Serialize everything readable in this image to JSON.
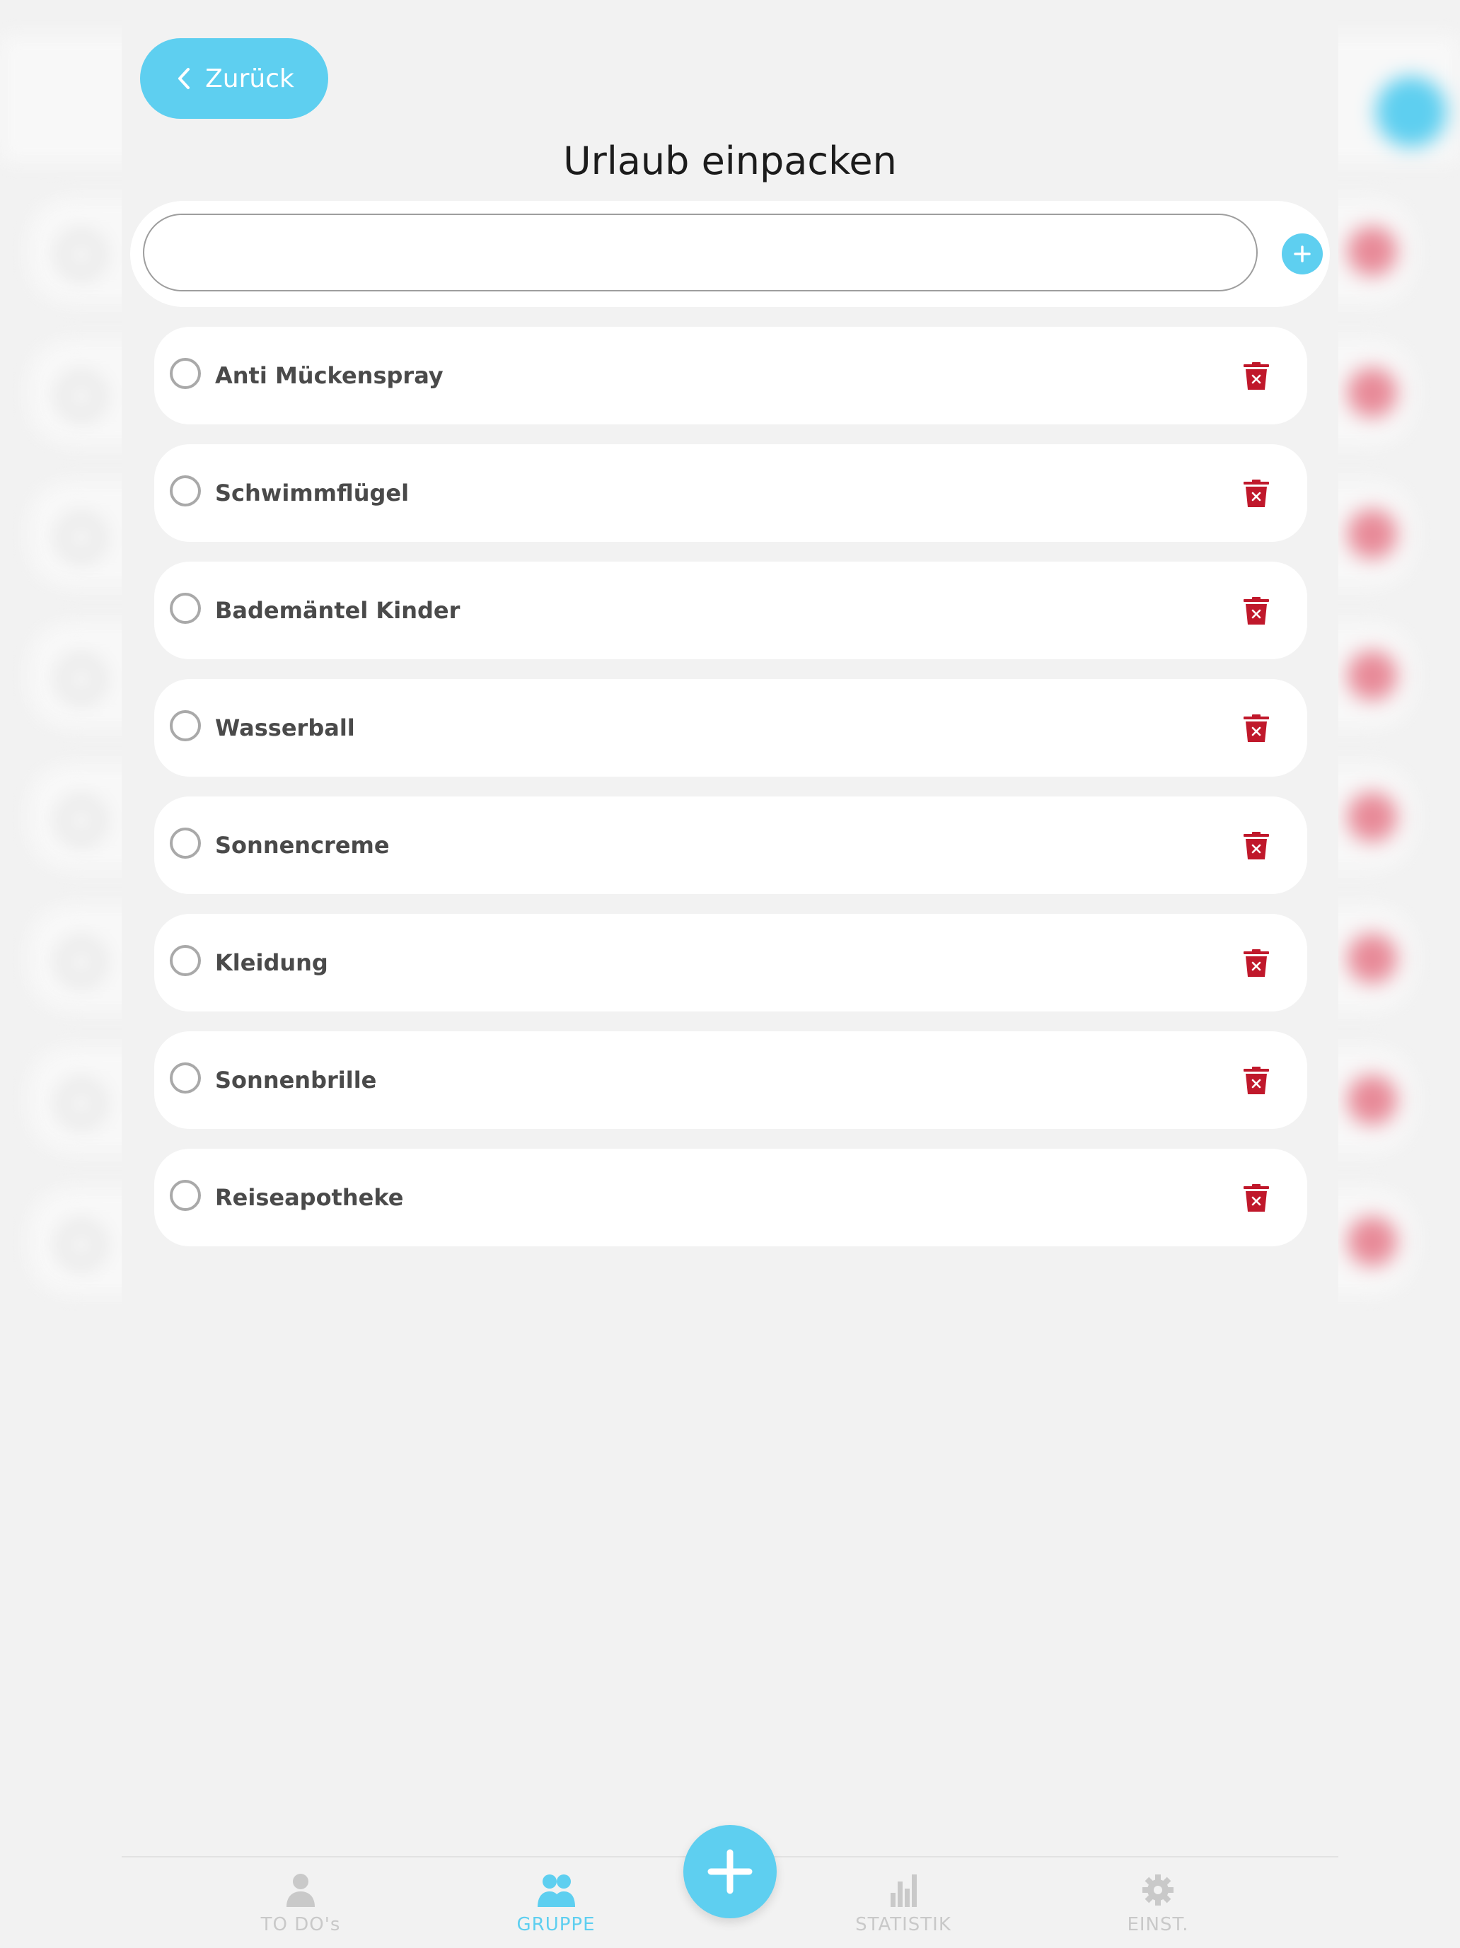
{
  "header": {
    "back_label": "Zurück",
    "title": "Urlaub einpacken"
  },
  "new_item": {
    "value": "",
    "placeholder": ""
  },
  "items": [
    {
      "label": "Anti Mückenspray",
      "checked": false
    },
    {
      "label": "Schwimmflügel",
      "checked": false
    },
    {
      "label": "Bademäntel Kinder",
      "checked": false
    },
    {
      "label": "Wasserball",
      "checked": false
    },
    {
      "label": "Sonnencreme",
      "checked": false
    },
    {
      "label": "Kleidung",
      "checked": false
    },
    {
      "label": "Sonnenbrille",
      "checked": false
    },
    {
      "label": "Reiseapotheke",
      "checked": false
    }
  ],
  "tabs": [
    {
      "label": "TO DO's",
      "icon": "person-icon",
      "active": false
    },
    {
      "label": "GRUPPE",
      "icon": "group-icon",
      "active": true
    },
    {
      "label": "STATISTIK",
      "icon": "bar-chart-icon",
      "active": false
    },
    {
      "label": "EINST.",
      "icon": "gear-icon",
      "active": false
    }
  ],
  "colors": {
    "accent": "#5ecff0",
    "delete": "#c0182b",
    "background": "#f2f2f2",
    "card": "#ffffff",
    "text": "#4a4a4a"
  }
}
